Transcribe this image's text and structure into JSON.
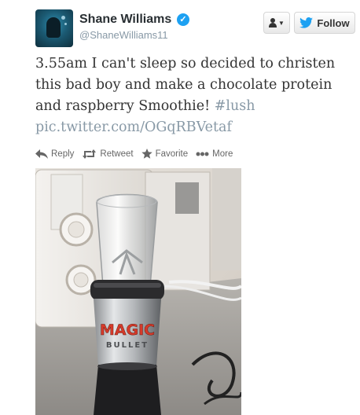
{
  "tweet": {
    "author_name": "Shane Williams",
    "author_handle": "@ShaneWilliams11",
    "verified": true,
    "text_main": "3.55am I can't sleep so decided to christen this bad boy and make a chocolate protein and raspberry Smoothie!",
    "hashtag": "#lush",
    "pic_link": "pic.twitter.com/OGqRBVetaf"
  },
  "buttons": {
    "follow_label": "Follow",
    "user_dropdown_icon": "person-icon"
  },
  "actions": [
    {
      "label": "Reply",
      "icon": "reply-icon"
    },
    {
      "label": "Retweet",
      "icon": "retweet-icon"
    },
    {
      "label": "Favorite",
      "icon": "star-icon"
    },
    {
      "label": "More",
      "icon": "more-dots-icon"
    }
  ],
  "photo": {
    "appliance_brand_line1": "MAGIC",
    "appliance_brand_line2": "BULLET"
  },
  "colors": {
    "twitter_blue": "#1da1f2",
    "text": "#333333",
    "muted": "#8899a6"
  }
}
